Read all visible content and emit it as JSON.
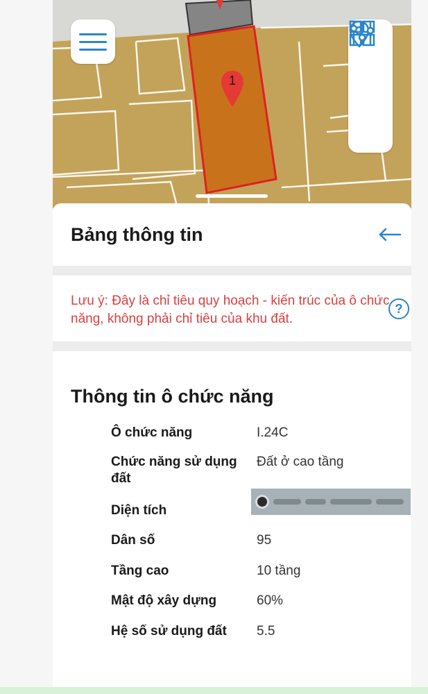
{
  "map": {
    "marker_label": "1",
    "icons": [
      "menu-icon",
      "grid-icon",
      "location-pin-icon",
      "sliders-icon"
    ],
    "colors": {
      "zone": "#c3a35a",
      "parcel": "#c8731b",
      "parcel_border": "#e02020",
      "marker": "#e53935",
      "accent": "#2a86c8"
    }
  },
  "panel": {
    "title": "Bảng thông tin",
    "back_icon": "arrow-left-icon"
  },
  "note": {
    "text": "Lưu ý: Đây là chỉ tiêu quy hoạch - kiến trúc của ô chức năng, không phải chỉ tiêu của khu đất.",
    "help_symbol": "?"
  },
  "info": {
    "title": "Thông tin ô chức năng",
    "rows": [
      {
        "label": "Ô chức năng",
        "value": "I.24C"
      },
      {
        "label": "Chức năng sử dụng đất",
        "value": "Đất ở cao tầng"
      },
      {
        "label": "Diện tích",
        "value": ""
      },
      {
        "label": "Dân số",
        "value": "95"
      },
      {
        "label": "Tầng cao",
        "value": "10 tầng"
      },
      {
        "label": "Mật độ xây dựng",
        "value": "60%"
      },
      {
        "label": "Hệ số sử dụng đất",
        "value": "5.5"
      }
    ]
  }
}
